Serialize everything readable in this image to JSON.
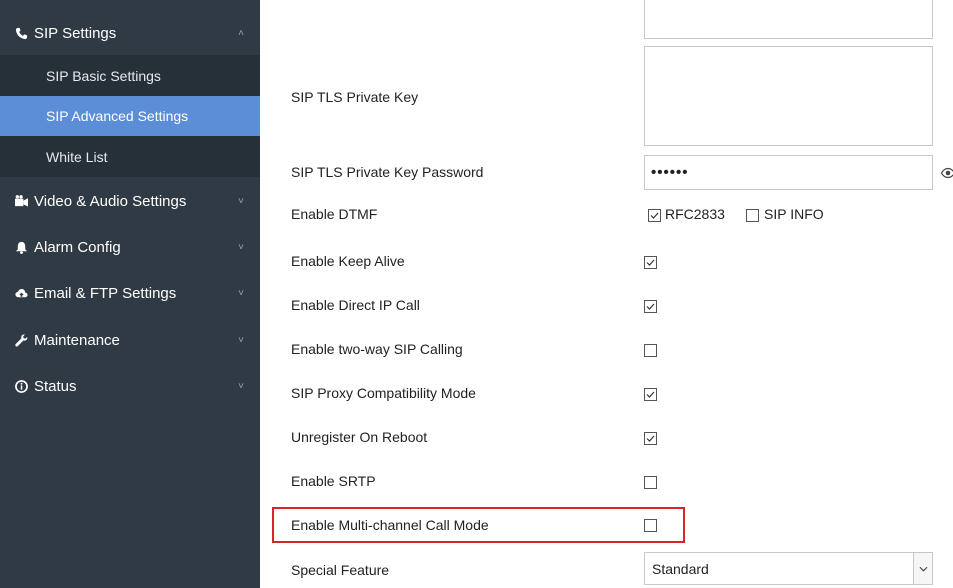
{
  "sidebar": {
    "sip_settings": {
      "label": "SIP Settings",
      "icon": "phone-icon",
      "expanded": true
    },
    "sub_items": [
      {
        "label": "SIP Basic Settings",
        "active": false
      },
      {
        "label": "SIP Advanced Settings",
        "active": true
      },
      {
        "label": "White List",
        "active": false
      }
    ],
    "groups": [
      {
        "label": "Video & Audio Settings",
        "icon": "video-icon"
      },
      {
        "label": "Alarm Config",
        "icon": "bell-icon"
      },
      {
        "label": "Email & FTP Settings",
        "icon": "cloud-icon"
      },
      {
        "label": "Maintenance",
        "icon": "wrench-icon"
      },
      {
        "label": "Status",
        "icon": "info-icon"
      }
    ],
    "colors": {
      "background": "#2f3a44",
      "active": "#5b8ed6"
    }
  },
  "form": {
    "tls_private_key_label": "SIP TLS Private Key",
    "tls_key_password_label": "SIP TLS Private Key Password",
    "tls_key_password_value": "••••••",
    "dtmf_label": "Enable DTMF",
    "dtmf_rfc2833_label": "RFC2833",
    "dtmf_rfc2833_checked": true,
    "dtmf_sipinfo_label": "SIP INFO",
    "dtmf_sipinfo_checked": false,
    "keep_alive_label": "Enable Keep Alive",
    "keep_alive_checked": true,
    "direct_ip_label": "Enable Direct IP Call",
    "direct_ip_checked": true,
    "two_way_label": "Enable two-way SIP Calling",
    "two_way_checked": false,
    "proxy_compat_label": "SIP Proxy Compatibility Mode",
    "proxy_compat_checked": true,
    "unregister_label": "Unregister On Reboot",
    "unregister_checked": true,
    "srtp_label": "Enable SRTP",
    "srtp_checked": false,
    "multichannel_label": "Enable Multi-channel Call Mode",
    "multichannel_checked": false,
    "special_feature_label": "Special Feature",
    "special_feature_value": "Standard",
    "highlight_color": "#d9232d"
  }
}
